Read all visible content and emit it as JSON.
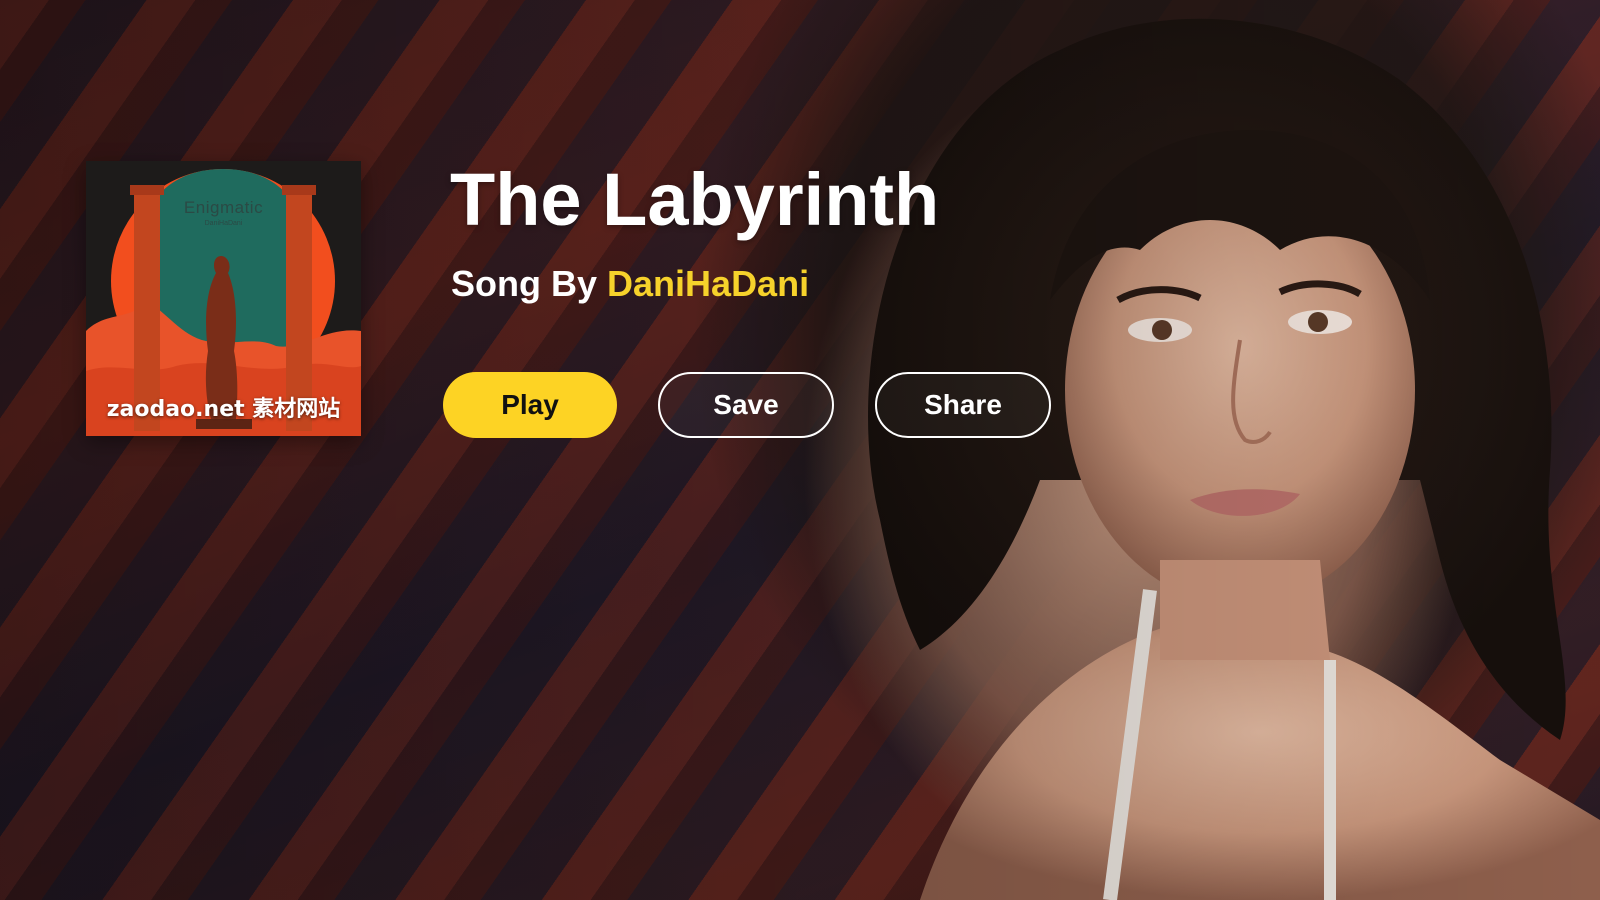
{
  "cover": {
    "title": "Enigmatic",
    "artist": "DaniHaDani",
    "watermark": "zaodao.net 素材网站"
  },
  "song": {
    "title": "The Labyrinth",
    "by_prefix": "Song By",
    "artist": "DaniHaDani"
  },
  "actions": {
    "play_label": "Play",
    "save_label": "Save",
    "share_label": "Share"
  },
  "colors": {
    "accent": "#fdd324",
    "artist_text": "#f6d22b",
    "title_text": "#ffffff"
  }
}
